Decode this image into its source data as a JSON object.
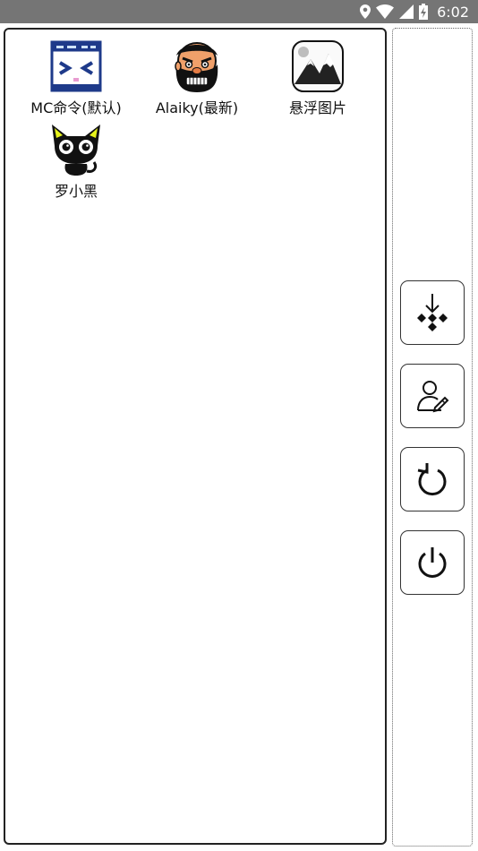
{
  "status_bar": {
    "time": "6:02",
    "icons": [
      "location-icon",
      "wifi-icon",
      "signal-icon",
      "battery-charging-icon"
    ]
  },
  "apps": [
    {
      "label": "MC命令(默认)",
      "icon": "mc-command-icon"
    },
    {
      "label": "Alaiky(最新)",
      "icon": "alaiky-icon"
    },
    {
      "label": "悬浮图片",
      "icon": "floating-image-icon"
    },
    {
      "label": "罗小黑",
      "icon": "luoxiaohei-icon"
    }
  ],
  "side_toolbar": {
    "buttons": [
      {
        "icon": "move-arrows-icon"
      },
      {
        "icon": "user-edit-icon"
      },
      {
        "icon": "refresh-icon"
      },
      {
        "icon": "power-icon"
      }
    ]
  },
  "colors": {
    "status_bar": "#757575",
    "panel_border": "#222222"
  }
}
